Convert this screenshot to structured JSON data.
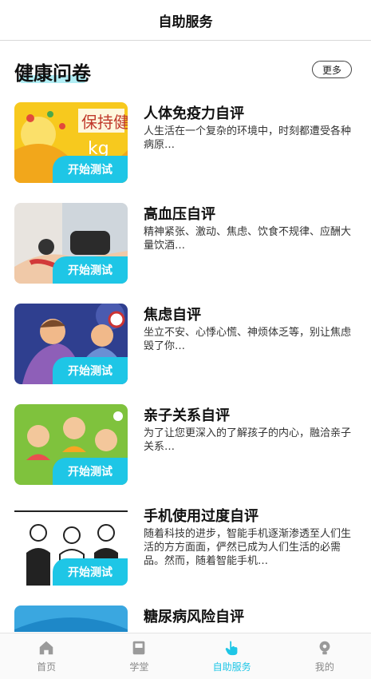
{
  "header": {
    "title": "自助服务"
  },
  "section": {
    "title": "健康问卷",
    "more_label": "更多"
  },
  "start_label": "开始测试",
  "items": [
    {
      "title": "人体免疫力自评",
      "desc": "人生活在一个复杂的环境中，时刻都遭受各种病原…"
    },
    {
      "title": "高血压自评",
      "desc": "精神紧张、激动、焦虑、饮食不规律、应酬大量饮酒…"
    },
    {
      "title": "焦虑自评",
      "desc": "坐立不安、心悸心慌、神烦体乏等，别让焦虑毁了你…"
    },
    {
      "title": "亲子关系自评",
      "desc": "为了让您更深入的了解孩子的内心，融洽亲子关系…"
    },
    {
      "title": "手机使用过度自评",
      "desc": "随着科技的进步，智能手机逐渐渗透至人们生活的方方面面，俨然已成为人们生活的必需品。然而，随着智能手机…"
    },
    {
      "title": "糖尿病风险自评",
      "desc": ""
    }
  ],
  "tabs": [
    {
      "label": "首页",
      "icon": "home-icon",
      "active": false
    },
    {
      "label": "学堂",
      "icon": "book-icon",
      "active": false
    },
    {
      "label": "自助服务",
      "icon": "hand-pointer-icon",
      "active": true
    },
    {
      "label": "我的",
      "icon": "user-icon",
      "active": false
    }
  ],
  "colors": {
    "accent": "#1ec6e6",
    "inactive": "#888888"
  }
}
